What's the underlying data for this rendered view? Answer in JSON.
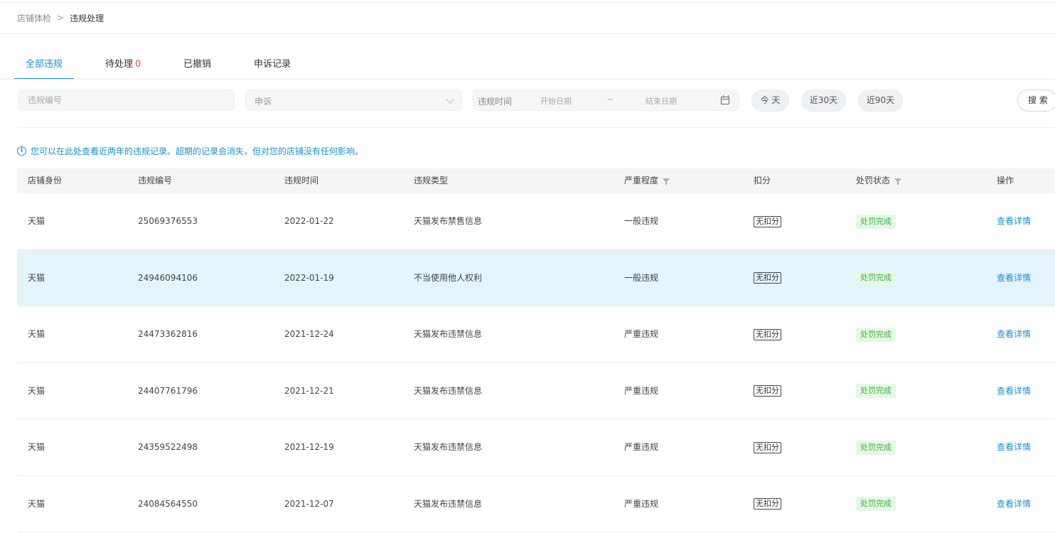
{
  "breadcrumb": {
    "root": "店铺体检",
    "separator": ">",
    "current": "违规处理"
  },
  "tabs": [
    {
      "label": "全部违规",
      "count": ""
    },
    {
      "label": "待处理",
      "count": "0"
    },
    {
      "label": "已撤销",
      "count": ""
    },
    {
      "label": "申诉记录",
      "count": ""
    }
  ],
  "filters": {
    "violation_id_placeholder": "违规编号",
    "appeal_select_value": "申诉",
    "date_label": "违规时间",
    "start_placeholder": "开始日期",
    "range_separator": "~",
    "end_placeholder": "结束日期",
    "quick": [
      "今 天",
      "近30天",
      "近90天"
    ],
    "search_label": "搜 索"
  },
  "notice": {
    "icon": "info-icon",
    "text": "您可以在此处查看近两年的违规记录。超期的记录会消失，但对您的店铺没有任何影响。"
  },
  "table": {
    "columns": [
      "店铺身份",
      "违规编号",
      "违规时间",
      "违规类型",
      "严重程度",
      "扣分",
      "处罚状态",
      "操作"
    ],
    "rows": [
      {
        "shop": "天猫",
        "id": "25069376553",
        "date": "2022-01-22",
        "type": "天猫发布禁售信息",
        "severity": "一般违规",
        "points": "无扣分",
        "status": "处罚完成",
        "action": "查看详情"
      },
      {
        "shop": "天猫",
        "id": "24946094106",
        "date": "2022-01-19",
        "type": "不当使用他人权利",
        "severity": "一般违规",
        "points": "无扣分",
        "status": "处罚完成",
        "action": "查看详情"
      },
      {
        "shop": "天猫",
        "id": "24473362816",
        "date": "2021-12-24",
        "type": "天猫发布违禁信息",
        "severity": "严重违规",
        "points": "无扣分",
        "status": "处罚完成",
        "action": "查看详情"
      },
      {
        "shop": "天猫",
        "id": "24407761796",
        "date": "2021-12-21",
        "type": "天猫发布违禁信息",
        "severity": "严重违规",
        "points": "无扣分",
        "status": "处罚完成",
        "action": "查看详情"
      },
      {
        "shop": "天猫",
        "id": "24359522498",
        "date": "2021-12-19",
        "type": "天猫发布违禁信息",
        "severity": "严重违规",
        "points": "无扣分",
        "status": "处罚完成",
        "action": "查看详情"
      },
      {
        "shop": "天猫",
        "id": "24084564550",
        "date": "2021-12-07",
        "type": "天猫发布违禁信息",
        "severity": "严重违规",
        "points": "无扣分",
        "status": "处罚完成",
        "action": "查看详情"
      }
    ]
  },
  "colors": {
    "accent": "#1890d5",
    "badge_red": "#e8503a",
    "status_green": "#3fb13f",
    "highlight_row": "#e3f4fb"
  }
}
